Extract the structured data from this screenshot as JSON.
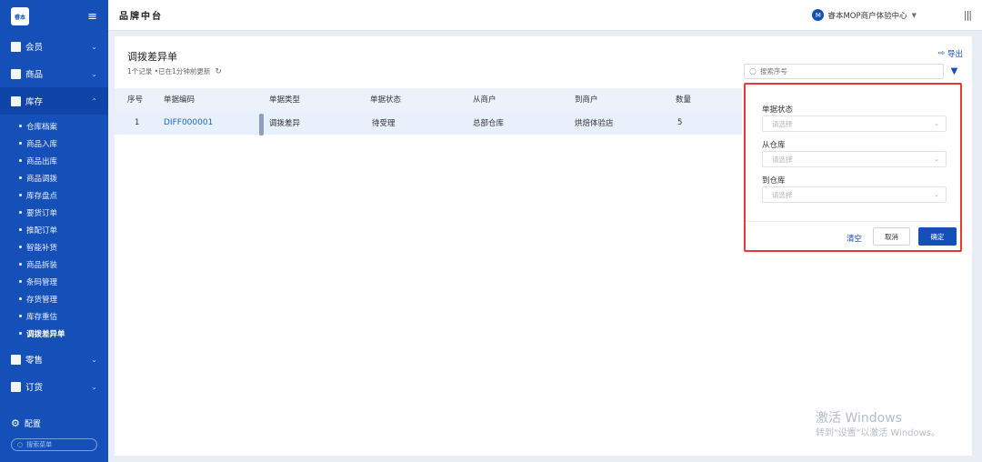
{
  "sidebar": {
    "logo": "睿本",
    "menu": [
      {
        "label": "会员"
      },
      {
        "label": "商品"
      },
      {
        "label": "库存"
      }
    ],
    "sub_items": [
      "仓库档案",
      "商品入库",
      "商品出库",
      "商品调拨",
      "库存盘点",
      "要货订单",
      "推配订单",
      "智能补货",
      "商品拆装",
      "条码管理",
      "存货管理",
      "库存重估",
      "调拨差异单"
    ],
    "menu_bottom": [
      {
        "label": "零售"
      },
      {
        "label": "订货"
      }
    ],
    "config_label": "配置",
    "search_placeholder": "搜索菜单"
  },
  "topbar": {
    "brand": "品牌中台",
    "merchant_badge": "M",
    "merchant_name": "睿本MOP商户体验中心"
  },
  "page": {
    "title": "调拨差异单",
    "meta": "1个记录 •已在1分钟前更新",
    "export_label": "导出",
    "search_placeholder": "搜索序号"
  },
  "table": {
    "columns": [
      "序号",
      "单据编码",
      "单据类型",
      "单据状态",
      "从商户",
      "到商户",
      "数量"
    ],
    "rows": [
      [
        "1",
        "DIFF000001",
        "调拨差异",
        "待受理",
        "总部仓库",
        "烘焙体验店",
        "5"
      ]
    ]
  },
  "filter": {
    "fields": [
      {
        "label": "单据状态",
        "placeholder": "请选择"
      },
      {
        "label": "从仓库",
        "placeholder": "请选择"
      },
      {
        "label": "到仓库",
        "placeholder": "请选择"
      }
    ],
    "clear_label": "清空",
    "cancel_label": "取消",
    "ok_label": "确定"
  },
  "watermark": {
    "line1": "激活 Windows",
    "line2": "转到\"设置\"以激活 Windows。"
  }
}
